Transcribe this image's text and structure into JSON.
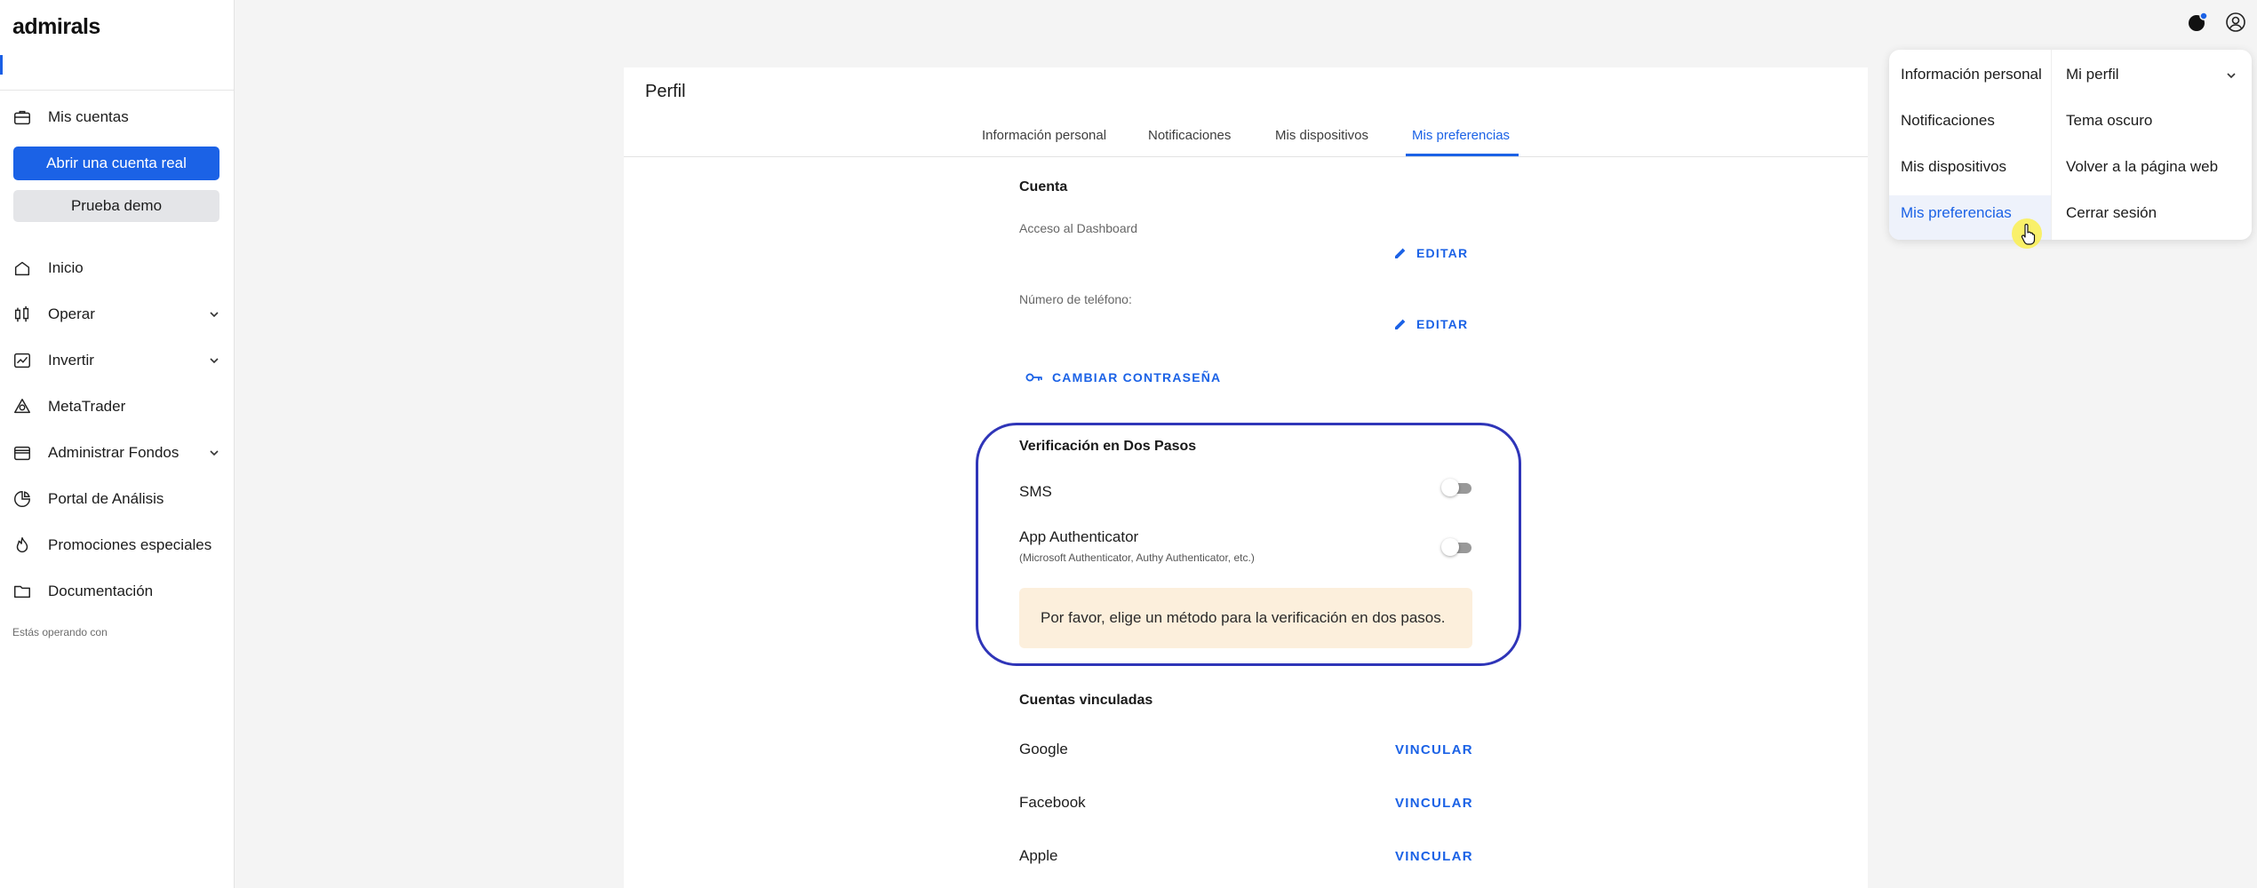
{
  "app": {
    "brand": "admirals"
  },
  "sidebar": {
    "accounts_label": "Mis cuentas",
    "open_real_label": "Abrir una cuenta real",
    "demo_label": "Prueba demo",
    "items": [
      {
        "label": "Inicio",
        "icon": "home-icon"
      },
      {
        "label": "Operar",
        "icon": "trade-icon",
        "expandable": true
      },
      {
        "label": "Invertir",
        "icon": "chart-icon",
        "expandable": true
      },
      {
        "label": "MetaTrader",
        "icon": "metatrader-icon"
      },
      {
        "label": "Administrar Fondos",
        "icon": "wallet-icon",
        "expandable": true
      },
      {
        "label": "Portal de Análisis",
        "icon": "pie-chart-icon"
      },
      {
        "label": "Promociones especiales",
        "icon": "flame-icon"
      },
      {
        "label": "Documentación",
        "icon": "folder-icon"
      }
    ],
    "footer_text": "Estás operando con"
  },
  "profile": {
    "title": "Perfil",
    "tabs": [
      {
        "label": "Información personal",
        "active": false
      },
      {
        "label": "Notificaciones",
        "active": false
      },
      {
        "label": "Mis dispositivos",
        "active": false
      },
      {
        "label": "Mis preferencias",
        "active": true
      }
    ],
    "account_section": {
      "heading": "Cuenta",
      "dashboard_access_label": "Acceso al Dashboard",
      "phone_label": "Número de teléfono:",
      "edit_label": "EDITAR",
      "change_password_label": "CAMBIAR CONTRASEÑA"
    },
    "two_step": {
      "heading": "Verificación en Dos Pasos",
      "sms_label": "SMS",
      "sms_enabled": false,
      "app_auth_label": "App Authenticator",
      "app_auth_sub": "(Microsoft Authenticator, Authy Authenticator, etc.)",
      "app_auth_enabled": false,
      "notice": "Por favor, elige un método para la verificación en dos pasos."
    },
    "linked_accounts": {
      "heading": "Cuentas vinculadas",
      "link_label": "VINCULAR",
      "providers": [
        "Google",
        "Facebook",
        "Apple"
      ]
    }
  },
  "dropdown": {
    "left_items": [
      {
        "label": "Información personal",
        "active": false
      },
      {
        "label": "Notificaciones",
        "active": false
      },
      {
        "label": "Mis dispositivos",
        "active": false
      },
      {
        "label": "Mis preferencias",
        "active": true
      }
    ],
    "right_items": [
      {
        "label": "Mi perfil",
        "expandable": true
      },
      {
        "label": "Tema oscuro"
      },
      {
        "label": "Volver a la página web"
      },
      {
        "label": "Cerrar sesión"
      }
    ]
  },
  "colors": {
    "accent": "#1b62e6",
    "highlight_ring": "#2f35b8",
    "notice_bg": "#fcefdc"
  }
}
